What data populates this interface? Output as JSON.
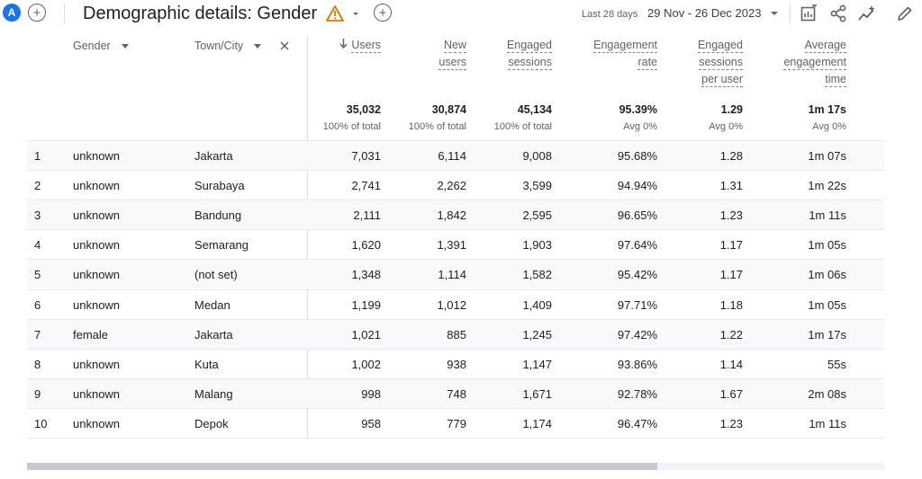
{
  "header": {
    "avatar_letter": "A",
    "title": "Demographic details: Gender",
    "date_label": "Last 28 days",
    "date_range": "29 Nov - 26 Dec 2023"
  },
  "table": {
    "dim_headers": [
      "Gender",
      "Town/City"
    ],
    "metric_headers": [
      {
        "lines": [
          "Users"
        ],
        "sorted": true
      },
      {
        "lines": [
          "New",
          "users"
        ]
      },
      {
        "lines": [
          "Engaged",
          "sessions"
        ]
      },
      {
        "lines": [
          "Engagement",
          "rate"
        ]
      },
      {
        "lines": [
          "Engaged",
          "sessions",
          "per user"
        ]
      },
      {
        "lines": [
          "Average",
          "engagement",
          "time"
        ]
      }
    ],
    "totals": [
      {
        "value": "35,032",
        "sub": "100% of total"
      },
      {
        "value": "30,874",
        "sub": "100% of total"
      },
      {
        "value": "45,134",
        "sub": "100% of total"
      },
      {
        "value": "95.39%",
        "sub": "Avg 0%"
      },
      {
        "value": "1.29",
        "sub": "Avg 0%"
      },
      {
        "value": "1m 17s",
        "sub": "Avg 0%"
      }
    ],
    "rows": [
      [
        "1",
        "unknown",
        "Jakarta",
        "7,031",
        "6,114",
        "9,008",
        "95.68%",
        "1.28",
        "1m 07s"
      ],
      [
        "2",
        "unknown",
        "Surabaya",
        "2,741",
        "2,262",
        "3,599",
        "94.94%",
        "1.31",
        "1m 22s"
      ],
      [
        "3",
        "unknown",
        "Bandung",
        "2,111",
        "1,842",
        "2,595",
        "96.65%",
        "1.23",
        "1m 11s"
      ],
      [
        "4",
        "unknown",
        "Semarang",
        "1,620",
        "1,391",
        "1,903",
        "97.64%",
        "1.17",
        "1m 05s"
      ],
      [
        "5",
        "unknown",
        "(not set)",
        "1,348",
        "1,114",
        "1,582",
        "95.42%",
        "1.17",
        "1m 06s"
      ],
      [
        "6",
        "unknown",
        "Medan",
        "1,199",
        "1,012",
        "1,409",
        "97.71%",
        "1.18",
        "1m 05s"
      ],
      [
        "7",
        "female",
        "Jakarta",
        "1,021",
        "885",
        "1,245",
        "97.42%",
        "1.22",
        "1m 17s"
      ],
      [
        "8",
        "unknown",
        "Kuta",
        "1,002",
        "938",
        "1,147",
        "93.86%",
        "1.14",
        "55s"
      ],
      [
        "9",
        "unknown",
        "Malang",
        "998",
        "748",
        "1,671",
        "92.78%",
        "1.67",
        "2m 08s"
      ],
      [
        "10",
        "unknown",
        "Depok",
        "958",
        "779",
        "1,174",
        "96.47%",
        "1.23",
        "1m 11s"
      ]
    ]
  },
  "icons": {
    "add": "plus-circle-icon",
    "warning": "warning-triangle-icon",
    "insights": "customize-report-icon",
    "share": "share-icon",
    "trend": "insights-sparkle-icon",
    "edit": "pencil-icon"
  },
  "colors": {
    "accent": "#1a73e8",
    "warning": "#e37400"
  }
}
